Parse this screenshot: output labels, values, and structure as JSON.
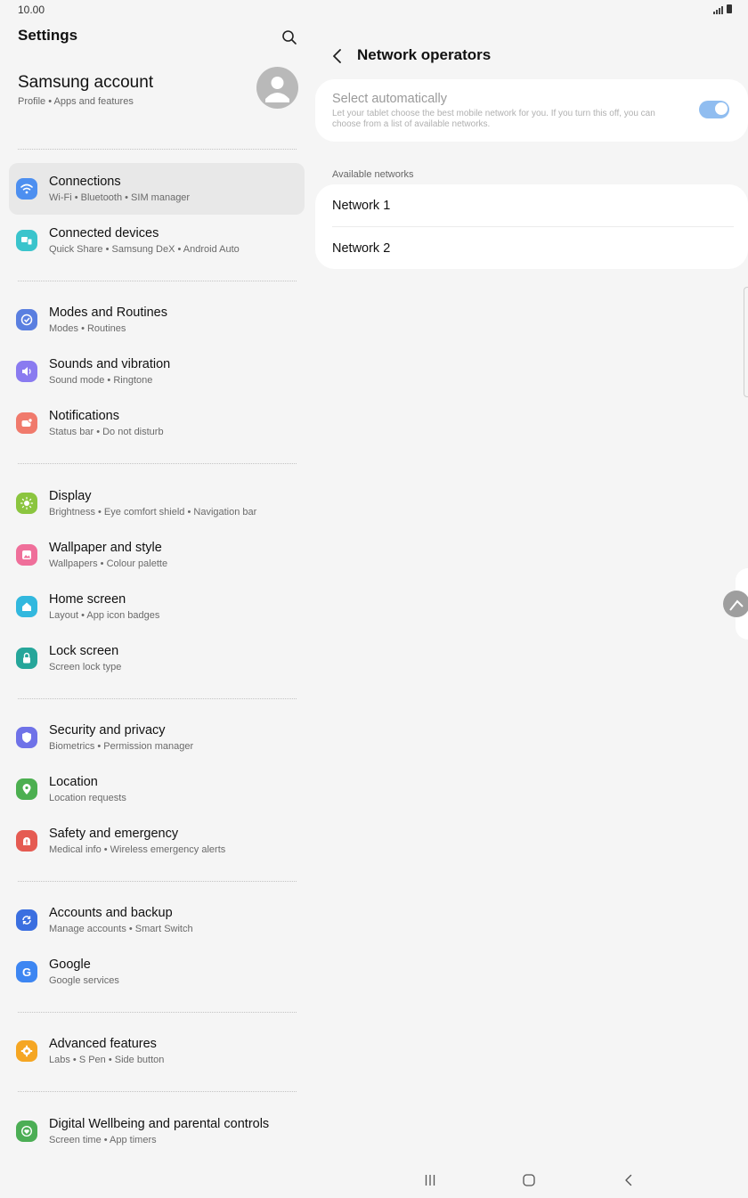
{
  "status": {
    "time": "10.00"
  },
  "left": {
    "title": "Settings",
    "account": {
      "title": "Samsung account",
      "subtitle": "Profile  •  Apps and features"
    },
    "items": [
      {
        "title": "Connections",
        "subtitle": "Wi-Fi  •  Bluetooth  •  SIM manager",
        "icon": "wifi-icon",
        "color": "#4d8ff0"
      },
      {
        "title": "Connected devices",
        "subtitle": "Quick Share  •  Samsung DeX  •  Android Auto",
        "icon": "connected-devices-icon",
        "color": "#3ac4cc"
      },
      {
        "title": "Modes and Routines",
        "subtitle": "Modes  •  Routines",
        "icon": "modes-icon",
        "color": "#5a7fe0"
      },
      {
        "title": "Sounds and vibration",
        "subtitle": "Sound mode  •  Ringtone",
        "icon": "sound-icon",
        "color": "#8a7bf0"
      },
      {
        "title": "Notifications",
        "subtitle": "Status bar  •  Do not disturb",
        "icon": "notifications-icon",
        "color": "#f07a6c"
      },
      {
        "title": "Display",
        "subtitle": "Brightness  •  Eye comfort shield  •  Navigation bar",
        "icon": "display-icon",
        "color": "#8bc53f"
      },
      {
        "title": "Wallpaper and style",
        "subtitle": "Wallpapers  •  Colour palette",
        "icon": "wallpaper-icon",
        "color": "#ef6f9a"
      },
      {
        "title": "Home screen",
        "subtitle": "Layout  •  App icon badges",
        "icon": "home-icon",
        "color": "#32b8de"
      },
      {
        "title": "Lock screen",
        "subtitle": "Screen lock type",
        "icon": "lock-icon",
        "color": "#26a69a"
      },
      {
        "title": "Security and privacy",
        "subtitle": "Biometrics  •  Permission manager",
        "icon": "shield-icon",
        "color": "#6f72e8"
      },
      {
        "title": "Location",
        "subtitle": "Location requests",
        "icon": "location-icon",
        "color": "#4caf50"
      },
      {
        "title": "Safety and emergency",
        "subtitle": "Medical info  •  Wireless emergency alerts",
        "icon": "emergency-icon",
        "color": "#e55b52"
      },
      {
        "title": "Accounts and backup",
        "subtitle": "Manage accounts  •  Smart Switch",
        "icon": "accounts-backup-icon",
        "color": "#3b6fe0"
      },
      {
        "title": "Google",
        "subtitle": "Google services",
        "icon": "google-icon",
        "color": "#3d86f2"
      },
      {
        "title": "Advanced features",
        "subtitle": "Labs  •  S Pen  •  Side button",
        "icon": "advanced-features-icon",
        "color": "#f5a623"
      },
      {
        "title": "Digital Wellbeing and parental controls",
        "subtitle": "Screen time  •  App timers",
        "icon": "wellbeing-icon",
        "color": "#4cae55"
      }
    ]
  },
  "right": {
    "title": "Network operators",
    "auto": {
      "title": "Select automatically",
      "description": "Let your tablet choose the best mobile network for you. If you turn this off, you can choose from a list of available networks.",
      "enabled": true
    },
    "section_label": "Available networks",
    "networks": [
      "Network 1",
      "Network 2"
    ]
  }
}
